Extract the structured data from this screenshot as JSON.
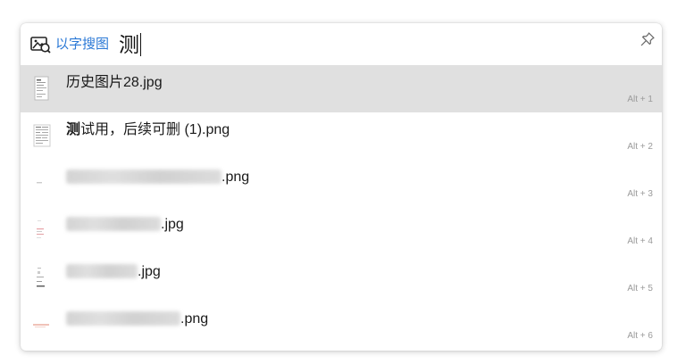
{
  "search": {
    "mode_label": "以字搜图",
    "query": "测"
  },
  "results": [
    {
      "prefix_bold": "",
      "name": "历史图片28.jpg",
      "shortcut": "Alt + 1",
      "selected": true
    },
    {
      "prefix_bold": "测",
      "name": "试用，后续可删 (1).png",
      "shortcut": "Alt + 2",
      "selected": false
    },
    {
      "prefix_bold": "",
      "name": ".png",
      "shortcut": "Alt + 3",
      "selected": false
    },
    {
      "prefix_bold": "",
      "name": ".jpg",
      "shortcut": "Alt + 4",
      "selected": false
    },
    {
      "prefix_bold": "",
      "name": ".jpg",
      "shortcut": "Alt + 5",
      "selected": false
    },
    {
      "prefix_bold": "",
      "name": ".png",
      "shortcut": "Alt + 6",
      "selected": false
    }
  ],
  "colors": {
    "accent": "#2b79d6",
    "selected_row": "#e0e0e0"
  },
  "icons": {
    "mode": "image-search-icon",
    "pin": "pin-icon"
  }
}
